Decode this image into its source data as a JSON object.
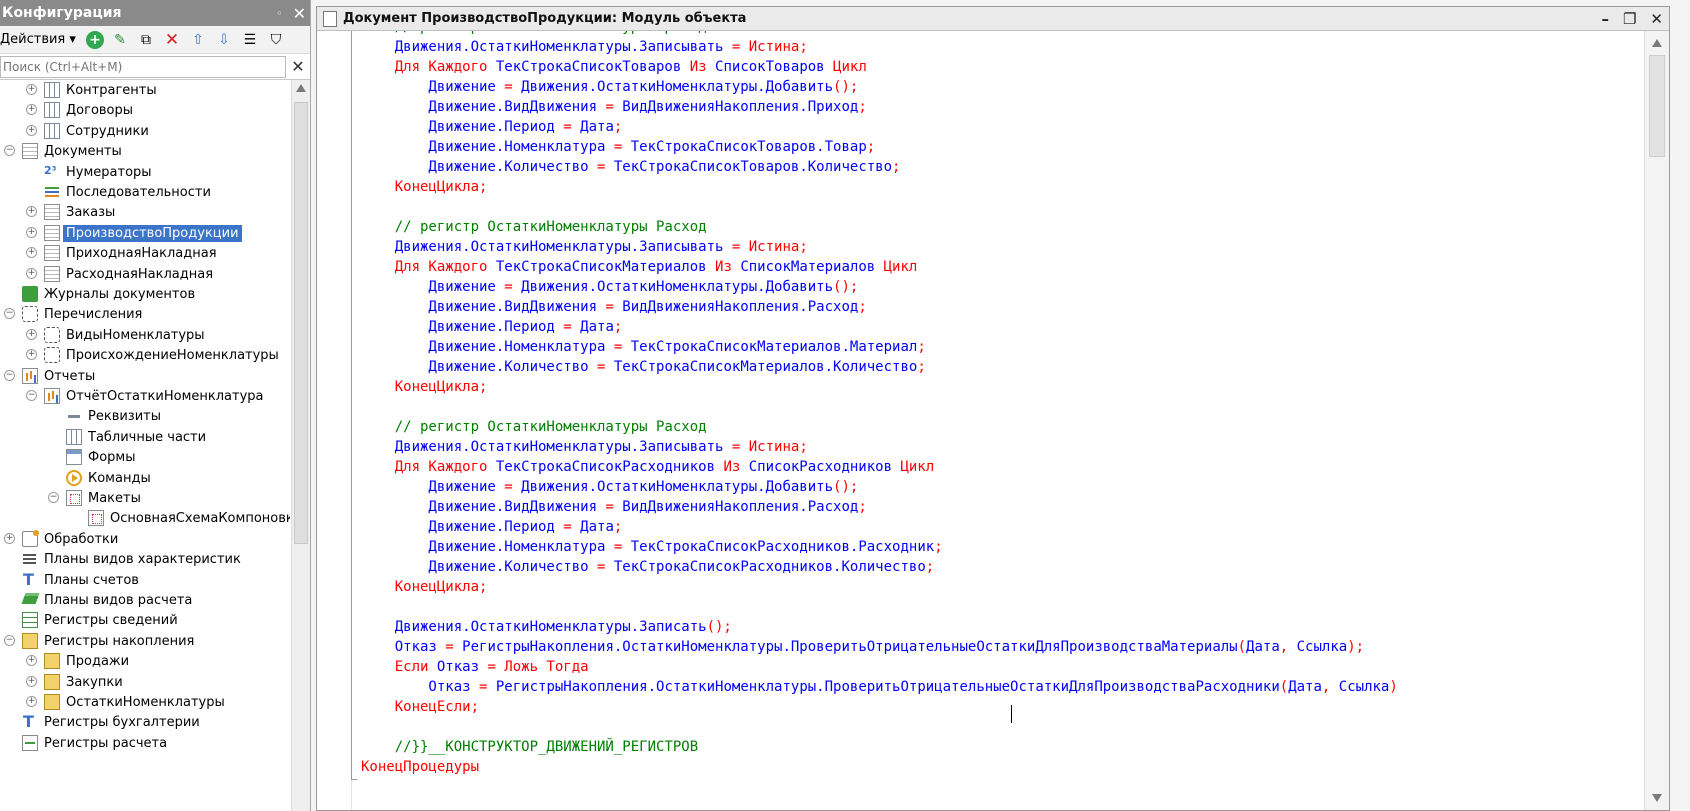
{
  "config_panel": {
    "title": "Конфигурация",
    "actions_label": "Действия",
    "search_placeholder": "Поиск (Ctrl+Alt+M)",
    "tree": [
      {
        "label": "Контрагенты",
        "icon": "table-icon",
        "depth": 1,
        "expander": "plus"
      },
      {
        "label": "Договоры",
        "icon": "table-icon",
        "depth": 1,
        "expander": "plus"
      },
      {
        "label": "Сотрудники",
        "icon": "table-icon",
        "depth": 1,
        "expander": "plus"
      },
      {
        "label": "Документы",
        "icon": "document-icon",
        "depth": 0,
        "expander": "minus"
      },
      {
        "label": "Нумераторы",
        "icon": "numerator-icon",
        "depth": 1,
        "expander": "none"
      },
      {
        "label": "Последовательности",
        "icon": "sequence-icon",
        "depth": 1,
        "expander": "none"
      },
      {
        "label": "Заказы",
        "icon": "document-icon",
        "depth": 1,
        "expander": "plus"
      },
      {
        "label": "ПроизводствоПродукции",
        "icon": "document-icon",
        "depth": 1,
        "expander": "plus",
        "selected": true
      },
      {
        "label": "ПриходнаяНакладная",
        "icon": "document-icon",
        "depth": 1,
        "expander": "plus"
      },
      {
        "label": "РасходнаяНакладная",
        "icon": "document-icon",
        "depth": 1,
        "expander": "plus"
      },
      {
        "label": "Журналы документов",
        "icon": "journal-icon",
        "depth": 0,
        "expander": "none"
      },
      {
        "label": "Перечисления",
        "icon": "enum-icon",
        "depth": 0,
        "expander": "minus"
      },
      {
        "label": "ВидыНоменклатуры",
        "icon": "enum-icon",
        "depth": 1,
        "expander": "plus"
      },
      {
        "label": "ПроисхождениеНоменклатуры",
        "icon": "enum-icon",
        "depth": 1,
        "expander": "plus"
      },
      {
        "label": "Отчеты",
        "icon": "report-icon",
        "depth": 0,
        "expander": "minus"
      },
      {
        "label": "ОтчётОстаткиНоменклатура",
        "icon": "report-icon",
        "depth": 1,
        "expander": "minus"
      },
      {
        "label": "Реквизиты",
        "icon": "attribute-icon",
        "depth": 2,
        "expander": "none"
      },
      {
        "label": "Табличные части",
        "icon": "table-icon",
        "depth": 2,
        "expander": "none"
      },
      {
        "label": "Формы",
        "icon": "form-icon",
        "depth": 2,
        "expander": "none"
      },
      {
        "label": "Команды",
        "icon": "command-icon",
        "depth": 2,
        "expander": "none"
      },
      {
        "label": "Макеты",
        "icon": "layout-icon",
        "depth": 2,
        "expander": "minus"
      },
      {
        "label": "ОсновнаяСхемаКомпоновкиДанных",
        "icon": "layout-icon",
        "depth": 3,
        "expander": "none"
      },
      {
        "label": "Обработки",
        "icon": "processing-icon",
        "depth": 0,
        "expander": "plus"
      },
      {
        "label": "Планы видов характеристик",
        "icon": "chart-icon",
        "depth": 0,
        "expander": "none"
      },
      {
        "label": "Планы счетов",
        "icon": "accounts-icon",
        "depth": 0,
        "expander": "none"
      },
      {
        "label": "Планы видов расчета",
        "icon": "layers-icon",
        "depth": 0,
        "expander": "none"
      },
      {
        "label": "Регистры сведений",
        "icon": "info-register-icon",
        "depth": 0,
        "expander": "none"
      },
      {
        "label": "Регистры накопления",
        "icon": "accumulation-register-icon",
        "depth": 0,
        "expander": "minus"
      },
      {
        "label": "Продажи",
        "icon": "accumulation-register-icon",
        "depth": 1,
        "expander": "plus"
      },
      {
        "label": "Закупки",
        "icon": "accumulation-register-icon",
        "depth": 1,
        "expander": "plus"
      },
      {
        "label": "ОстаткиНоменклатуры",
        "icon": "accumulation-register-icon",
        "depth": 1,
        "expander": "plus"
      },
      {
        "label": "Регистры бухгалтерии",
        "icon": "accounting-register-icon",
        "depth": 0,
        "expander": "none"
      },
      {
        "label": "Регистры расчета",
        "icon": "calculation-register-icon",
        "depth": 0,
        "expander": "none"
      }
    ]
  },
  "editor": {
    "title": "Документ ПроизводствоПродукции: Модуль объекта",
    "code_lines": [
      [
        [
          "cm",
          "    // регистр ОстаткиНоменклатуры Приход"
        ]
      ],
      [
        [
          "id",
          "    Движения.ОстаткиНоменклатуры.Записывать "
        ],
        [
          "op",
          "="
        ],
        [
          "kw",
          " Истина"
        ],
        [
          "op",
          ";"
        ]
      ],
      [
        [
          "kw",
          "    Для Каждого "
        ],
        [
          "id",
          "ТекСтрокаСписокТоваров "
        ],
        [
          "kw",
          "Из "
        ],
        [
          "id",
          "СписокТоваров "
        ],
        [
          "kw",
          "Цикл"
        ]
      ],
      [
        [
          "id",
          "        Движение "
        ],
        [
          "op",
          "="
        ],
        [
          "id",
          " Движения.ОстаткиНоменклатуры.Добавить"
        ],
        [
          "op",
          "();"
        ]
      ],
      [
        [
          "id",
          "        Движение.ВидДвижения "
        ],
        [
          "op",
          "="
        ],
        [
          "id",
          " ВидДвиженияНакопления.Приход"
        ],
        [
          "op",
          ";"
        ]
      ],
      [
        [
          "id",
          "        Движение.Период "
        ],
        [
          "op",
          "="
        ],
        [
          "id",
          " Дата"
        ],
        [
          "op",
          ";"
        ]
      ],
      [
        [
          "id",
          "        Движение.Номенклатура "
        ],
        [
          "op",
          "="
        ],
        [
          "id",
          " ТекСтрокаСписокТоваров.Товар"
        ],
        [
          "op",
          ";"
        ]
      ],
      [
        [
          "id",
          "        Движение.Количество "
        ],
        [
          "op",
          "="
        ],
        [
          "id",
          " ТекСтрокаСписокТоваров.Количество"
        ],
        [
          "op",
          ";"
        ]
      ],
      [
        [
          "kw",
          "    КонецЦикла"
        ],
        [
          "op",
          ";"
        ]
      ],
      [
        [
          "id",
          ""
        ]
      ],
      [
        [
          "cm",
          "    // регистр ОстаткиНоменклатуры Расход"
        ]
      ],
      [
        [
          "id",
          "    Движения.ОстаткиНоменклатуры.Записывать "
        ],
        [
          "op",
          "="
        ],
        [
          "kw",
          " Истина"
        ],
        [
          "op",
          ";"
        ]
      ],
      [
        [
          "kw",
          "    Для Каждого "
        ],
        [
          "id",
          "ТекСтрокаСписокМатериалов "
        ],
        [
          "kw",
          "Из "
        ],
        [
          "id",
          "СписокМатериалов "
        ],
        [
          "kw",
          "Цикл"
        ]
      ],
      [
        [
          "id",
          "        Движение "
        ],
        [
          "op",
          "="
        ],
        [
          "id",
          " Движения.ОстаткиНоменклатуры.Добавить"
        ],
        [
          "op",
          "();"
        ]
      ],
      [
        [
          "id",
          "        Движение.ВидДвижения "
        ],
        [
          "op",
          "="
        ],
        [
          "id",
          " ВидДвиженияНакопления.Расход"
        ],
        [
          "op",
          ";"
        ]
      ],
      [
        [
          "id",
          "        Движение.Период "
        ],
        [
          "op",
          "="
        ],
        [
          "id",
          " Дата"
        ],
        [
          "op",
          ";"
        ]
      ],
      [
        [
          "id",
          "        Движение.Номенклатура "
        ],
        [
          "op",
          "="
        ],
        [
          "id",
          " ТекСтрокаСписокМатериалов.Материал"
        ],
        [
          "op",
          ";"
        ]
      ],
      [
        [
          "id",
          "        Движение.Количество "
        ],
        [
          "op",
          "="
        ],
        [
          "id",
          " ТекСтрокаСписокМатериалов.Количество"
        ],
        [
          "op",
          ";"
        ]
      ],
      [
        [
          "kw",
          "    КонецЦикла"
        ],
        [
          "op",
          ";"
        ]
      ],
      [
        [
          "id",
          ""
        ]
      ],
      [
        [
          "cm",
          "    // регистр ОстаткиНоменклатуры Расход"
        ]
      ],
      [
        [
          "id",
          "    Движения.ОстаткиНоменклатуры.Записывать "
        ],
        [
          "op",
          "="
        ],
        [
          "kw",
          " Истина"
        ],
        [
          "op",
          ";"
        ]
      ],
      [
        [
          "kw",
          "    Для Каждого "
        ],
        [
          "id",
          "ТекСтрокаСписокРасходников "
        ],
        [
          "kw",
          "Из "
        ],
        [
          "id",
          "СписокРасходников "
        ],
        [
          "kw",
          "Цикл"
        ]
      ],
      [
        [
          "id",
          "        Движение "
        ],
        [
          "op",
          "="
        ],
        [
          "id",
          " Движения.ОстаткиНоменклатуры.Добавить"
        ],
        [
          "op",
          "();"
        ]
      ],
      [
        [
          "id",
          "        Движение.ВидДвижения "
        ],
        [
          "op",
          "="
        ],
        [
          "id",
          " ВидДвиженияНакопления.Расход"
        ],
        [
          "op",
          ";"
        ]
      ],
      [
        [
          "id",
          "        Движение.Период "
        ],
        [
          "op",
          "="
        ],
        [
          "id",
          " Дата"
        ],
        [
          "op",
          ";"
        ]
      ],
      [
        [
          "id",
          "        Движение.Номенклатура "
        ],
        [
          "op",
          "="
        ],
        [
          "id",
          " ТекСтрокаСписокРасходников.Расходник"
        ],
        [
          "op",
          ";"
        ]
      ],
      [
        [
          "id",
          "        Движение.Количество "
        ],
        [
          "op",
          "="
        ],
        [
          "id",
          " ТекСтрокаСписокРасходников.Количество"
        ],
        [
          "op",
          ";"
        ]
      ],
      [
        [
          "kw",
          "    КонецЦикла"
        ],
        [
          "op",
          ";"
        ]
      ],
      [
        [
          "id",
          ""
        ]
      ],
      [
        [
          "id",
          "    Движения.ОстаткиНоменклатуры.Записать"
        ],
        [
          "op",
          "();"
        ]
      ],
      [
        [
          "id",
          "    Отказ "
        ],
        [
          "op",
          "="
        ],
        [
          "id",
          " РегистрыНакопления.ОстаткиНоменклатуры.ПроверитьОтрицательныеОстаткиДляПроизводстваМатериалы"
        ],
        [
          "op",
          "("
        ],
        [
          "id",
          "Дата"
        ],
        [
          "op",
          ","
        ],
        [
          "id",
          " Ссылка"
        ],
        [
          "op",
          ");"
        ]
      ],
      [
        [
          "kw",
          "    Если "
        ],
        [
          "id",
          "Отказ "
        ],
        [
          "op",
          "="
        ],
        [
          "kw",
          " Ложь Тогда"
        ]
      ],
      [
        [
          "id",
          "        Отказ "
        ],
        [
          "op",
          "="
        ],
        [
          "id",
          " РегистрыНакопления.ОстаткиНоменклатуры.ПроверитьОтрицательныеОстаткиДляПроизводстваРасходники"
        ],
        [
          "op",
          "("
        ],
        [
          "id",
          "Дата"
        ],
        [
          "op",
          ","
        ],
        [
          "id",
          " Ссылка"
        ],
        [
          "op",
          ")"
        ]
      ],
      [
        [
          "kw",
          "    КонецЕсли"
        ],
        [
          "op",
          ";"
        ]
      ],
      [
        [
          "id",
          ""
        ]
      ],
      [
        [
          "cm",
          "    //}}__КОНСТРУКТОР_ДВИЖЕНИЙ_РЕГИСТРОВ"
        ]
      ],
      [
        [
          "kw",
          "КонецПроцедуры"
        ]
      ]
    ]
  },
  "colors": {
    "keyword": "#ff0000",
    "identifier": "#0000ff",
    "comment": "#008000",
    "selection": "#3b74c8"
  }
}
